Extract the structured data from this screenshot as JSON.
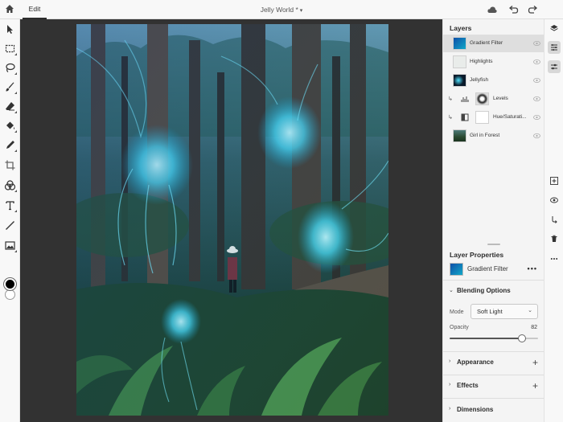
{
  "topbar": {
    "edit_tab": "Edit",
    "document_title": "Jelly World *",
    "icons": [
      "home-icon",
      "cloud-icon",
      "undo-icon",
      "redo-icon"
    ]
  },
  "left_toolbar": {
    "tools": [
      "select-tool",
      "marquee-tool",
      "lasso-tool",
      "brush-tool",
      "eraser-tool",
      "fill-tool",
      "healing-tool",
      "crop-tool",
      "shape-tool",
      "type-tool",
      "line-tool",
      "image-place-tool"
    ],
    "foreground_color": "#000000",
    "background_color": "#ffffff"
  },
  "layers_panel": {
    "title": "Layers",
    "layers": [
      {
        "name": "Gradient Filter",
        "selected": true
      },
      {
        "name": "Highlights",
        "selected": false
      },
      {
        "name": "Jellyfish",
        "selected": false
      },
      {
        "name": "Levels",
        "selected": false
      },
      {
        "name": "Hue/Saturati...",
        "selected": false
      },
      {
        "name": "Girl in Forest",
        "selected": false
      }
    ]
  },
  "properties_panel": {
    "title": "Layer Properties",
    "layer_name": "Gradient Filter",
    "more_label": "•••",
    "blending_options": "Blending Options",
    "mode_label": "Mode",
    "mode_value": "Soft Light",
    "opacity_label": "Opacity",
    "opacity_value": "82",
    "opacity_fraction": 0.82,
    "sections": [
      "Appearance",
      "Effects",
      "Dimensions"
    ]
  },
  "right_strip": {
    "icons": [
      "layers-icon",
      "layer-properties-icon",
      "adjustments-icon",
      "add-layer-icon",
      "visibility-icon",
      "clip-icon",
      "delete-icon",
      "more-icon"
    ]
  },
  "colors": {
    "accent_selected": "#dedede",
    "canvas_bg": "#323232",
    "jellyfish_glow": "#4fe3ff"
  }
}
